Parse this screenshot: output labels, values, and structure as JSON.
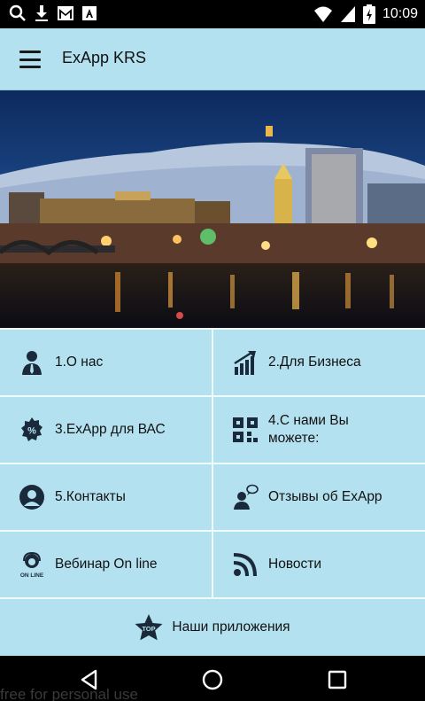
{
  "status_bar": {
    "time": "10:09",
    "icons_left": [
      "search-icon",
      "download-icon",
      "gmail-icon",
      "a-icon"
    ],
    "icons_right": [
      "wifi-icon",
      "cell-signal-icon",
      "battery-icon"
    ]
  },
  "app_bar": {
    "title": "ExApp KRS",
    "menu_icon": "hamburger-menu-icon"
  },
  "banner": {
    "image": "Krasnoyarsk city at night"
  },
  "menu": {
    "items": [
      {
        "label": "1.О нас",
        "icon": "person-icon"
      },
      {
        "label": "2.Для Бизнеса",
        "icon": "growth-chart-icon"
      },
      {
        "label": "3.ExApp для ВАС",
        "icon": "percent-badge-icon"
      },
      {
        "label": "4.С нами Вы можете:",
        "icon": "qr-grid-icon"
      },
      {
        "label": "5.Контакты",
        "icon": "contact-icon"
      },
      {
        "label": "Отзывы об ExApp",
        "icon": "review-person-icon"
      },
      {
        "label": "Вебинар On line",
        "icon": "webinar-icon"
      },
      {
        "label": "Новости",
        "icon": "rss-icon"
      }
    ],
    "bottom": {
      "label": "Наши приложения",
      "icon": "top-star-icon"
    }
  },
  "nav_bar": {
    "buttons": [
      "back-icon",
      "home-icon",
      "recents-icon"
    ]
  },
  "watermark": "free for personal use",
  "colors": {
    "accent": "#b3e1ef",
    "divider": "#f0fbff",
    "icon": "#1b2a3a"
  }
}
